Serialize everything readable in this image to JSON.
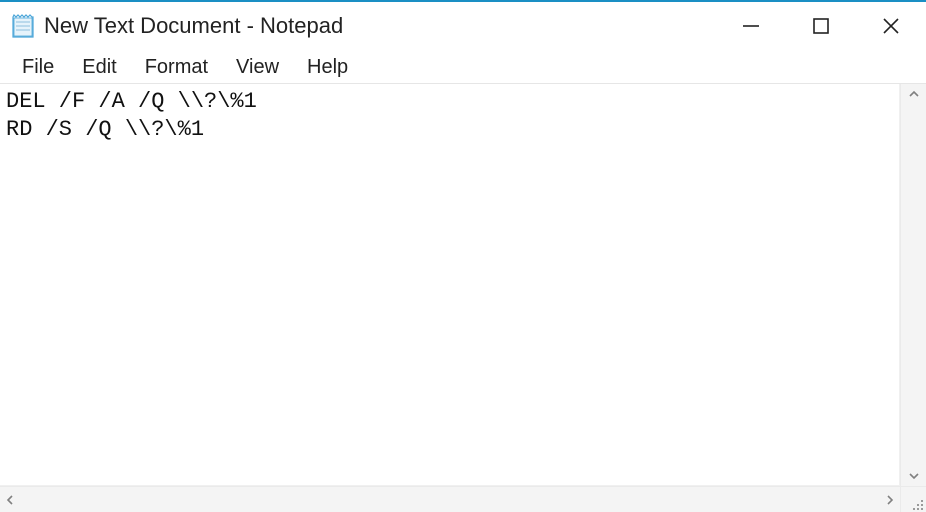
{
  "window": {
    "title": "New Text Document - Notepad"
  },
  "menu": {
    "items": [
      "File",
      "Edit",
      "Format",
      "View",
      "Help"
    ]
  },
  "editor": {
    "content": "DEL /F /A /Q \\\\?\\%1\nRD /S /Q \\\\?\\%1"
  }
}
